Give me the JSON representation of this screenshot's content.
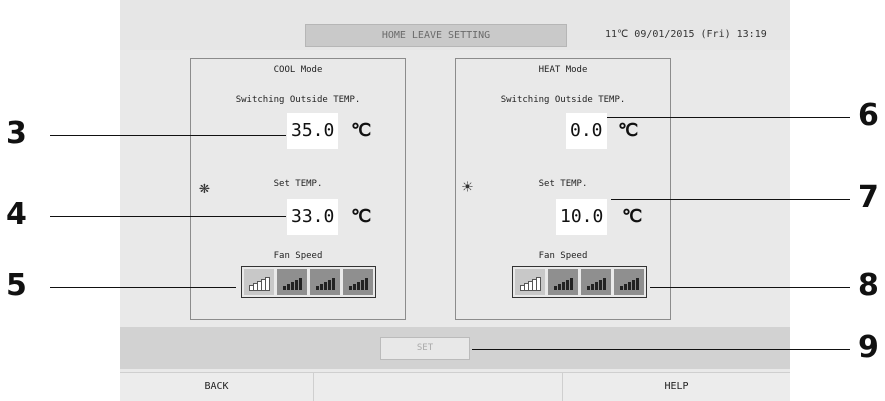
{
  "header": {
    "title": "HOME LEAVE SETTING",
    "datetime": "11℃ 09/01/2015 (Fri) 13:19"
  },
  "cool": {
    "mode_label": "COOL Mode",
    "switching_label": "Switching Outside TEMP.",
    "switching_value": "35.0",
    "unit": "℃",
    "set_temp_label": "Set TEMP.",
    "set_temp_value": "33.0",
    "fan_label": "Fan Speed",
    "fan_selected_level": 1,
    "icon": "snowflake-icon"
  },
  "heat": {
    "mode_label": "HEAT Mode",
    "switching_label": "Switching Outside TEMP.",
    "switching_value": "0.0",
    "unit": "℃",
    "set_temp_label": "Set TEMP.",
    "set_temp_value": "10.0",
    "fan_label": "Fan Speed",
    "fan_selected_level": 1,
    "icon": "sun-icon"
  },
  "set_button": "SET",
  "footer": {
    "back": "BACK",
    "help": "HELP"
  },
  "callouts": [
    "3",
    "4",
    "5",
    "6",
    "7",
    "8",
    "9"
  ]
}
